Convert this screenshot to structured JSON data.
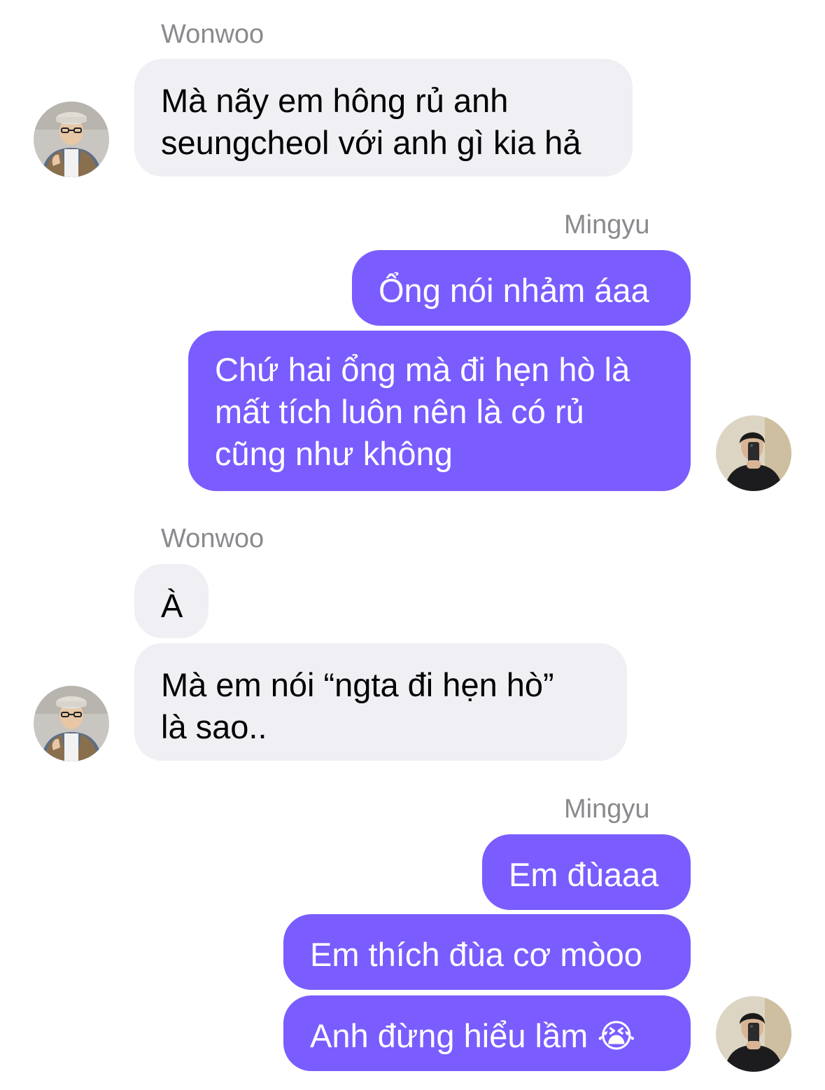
{
  "conversation": {
    "colors": {
      "incoming_bubble": "#efeff4",
      "outgoing_bubble": "#7b5cff",
      "sender_label": "#8a8a8e"
    },
    "groups": [
      {
        "sender": "Wonwoo",
        "direction": "incoming",
        "avatar": "wonwoo-avatar",
        "messages": [
          "Mà nãy em hông rủ anh\nseungcheol với anh gì kia hả"
        ]
      },
      {
        "sender": "Mingyu",
        "direction": "outgoing",
        "avatar": "mingyu-avatar",
        "messages": [
          "Ổng nói nhảm áaa",
          "Chứ hai ổng mà đi hẹn hò là\nmất tích luôn nên là có rủ\ncũng như không"
        ]
      },
      {
        "sender": "Wonwoo",
        "direction": "incoming",
        "avatar": "wonwoo-avatar",
        "messages": [
          "À",
          "Mà em nói “ngta đi hẹn hò”\nlà sao.."
        ]
      },
      {
        "sender": "Mingyu",
        "direction": "outgoing",
        "avatar": "mingyu-avatar",
        "messages": [
          "Em đùaaa",
          "Em thích đùa cơ mòoo",
          "Anh đừng hiểu lầm 😭"
        ]
      }
    ]
  }
}
